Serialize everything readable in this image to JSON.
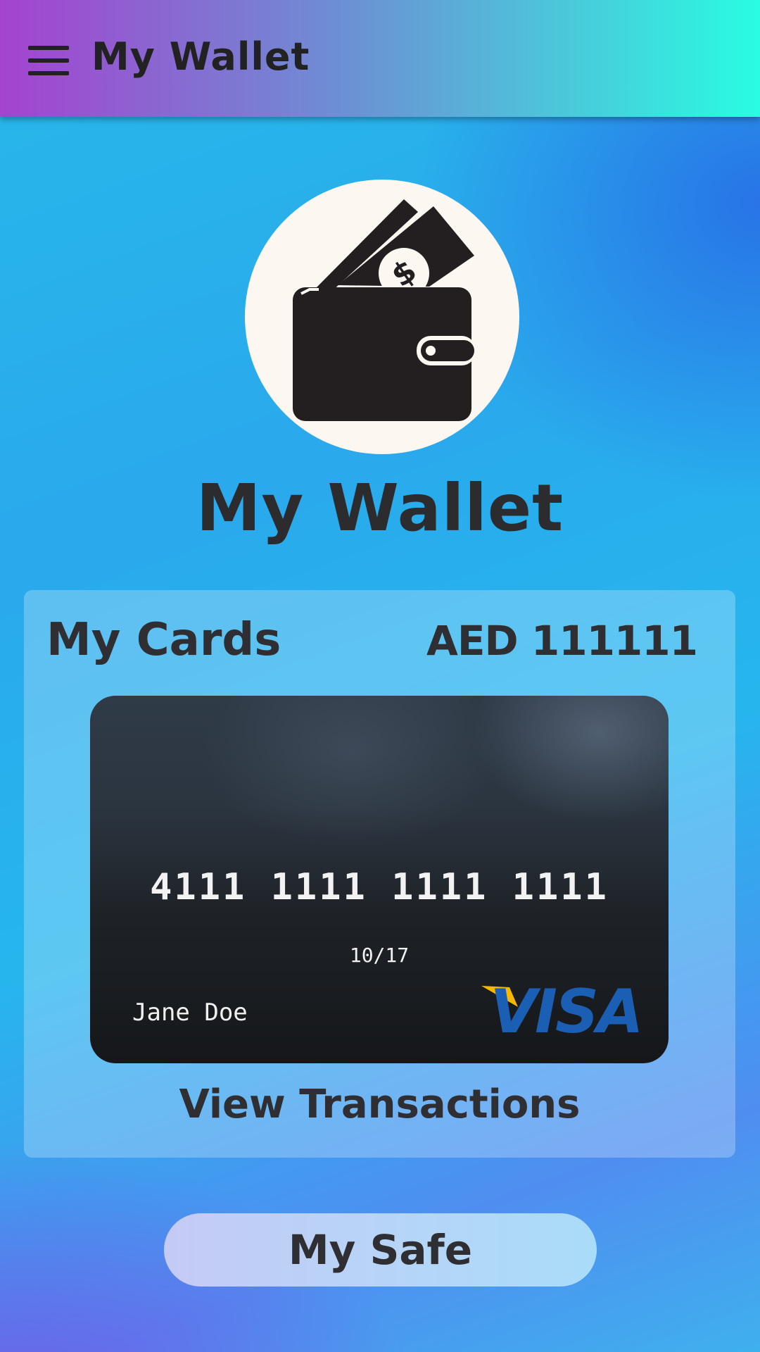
{
  "appbar": {
    "title": "My Wallet",
    "menu_icon": "hamburger-menu-icon"
  },
  "hero": {
    "logo_icon": "wallet-with-money-icon",
    "title": "My Wallet"
  },
  "cards_panel": {
    "label": "My Cards",
    "balance": "AED 111111",
    "card": {
      "number": "4111 1111 1111 1111",
      "expiry": "10/17",
      "holder": "Jane Doe",
      "brand": "VISA",
      "brand_color": "#1a5fb4",
      "brand_accent": "#f7b600"
    },
    "view_transactions_label": "View Transactions"
  },
  "safe_button": {
    "label": "My Safe"
  },
  "colors": {
    "appbar_gradient_start": "#a443cf",
    "appbar_gradient_end": "#28fde1",
    "text_dark": "#2f2f33",
    "logo_background": "#fcf8f1"
  }
}
